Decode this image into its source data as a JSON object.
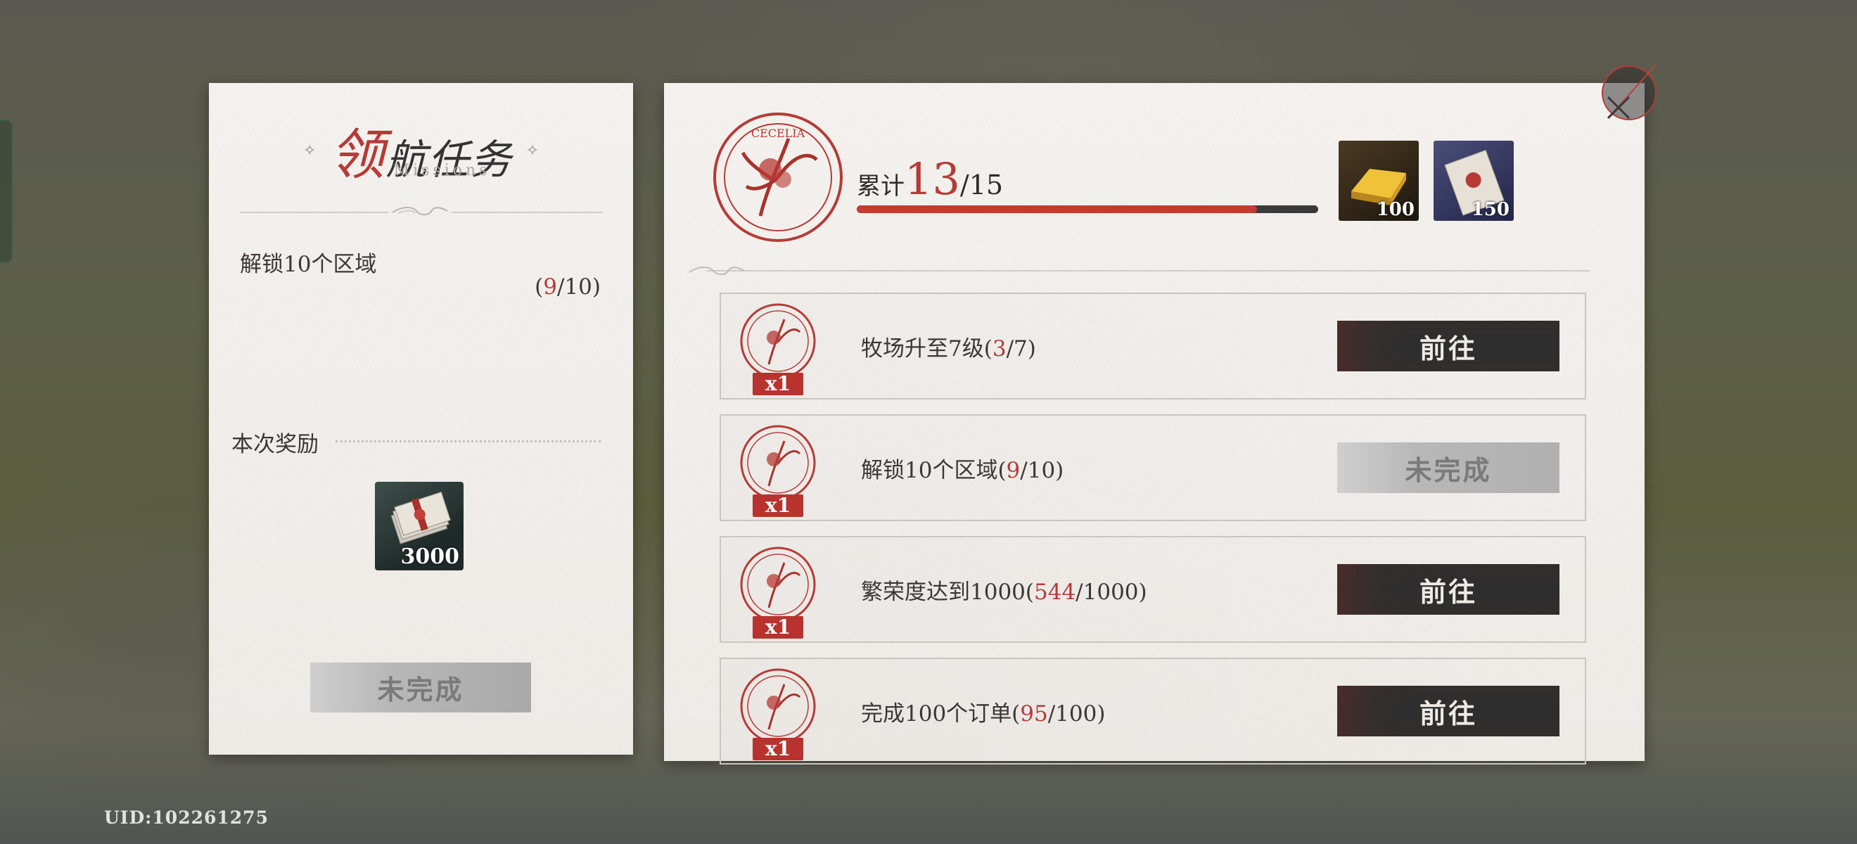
{
  "left_panel": {
    "title_first_char": "领",
    "title_rest": "航任务",
    "title_deco": "✧",
    "subtitle": "Missions",
    "mission_name": "解锁10个区域",
    "mission_progress": {
      "open": "(",
      "current": "9",
      "sep_max": "/10)"
    },
    "reward_label": "本次奖励",
    "reward": {
      "icon": "cash-bundle-icon",
      "quantity": "3000"
    },
    "status_button": "未完成"
  },
  "right_panel": {
    "seal_text": "CECELIA",
    "total": {
      "label": "累计",
      "current": "13",
      "max": "/15",
      "progress": 0.867
    },
    "milestone_rewards": [
      {
        "icon": "gold-bar-icon",
        "quantity": "100"
      },
      {
        "icon": "sealed-letter-icon",
        "quantity": "150"
      }
    ],
    "missions": [
      {
        "text_pre": "牧场升至7级(",
        "current": "3",
        "text_post": "/7)",
        "reward_badge": "x1",
        "button": "前往",
        "state": "go"
      },
      {
        "text_pre": "解锁10个区域(",
        "current": "9",
        "text_post": "/10)",
        "reward_badge": "x1",
        "button": "未完成",
        "state": "incomplete"
      },
      {
        "text_pre": "繁荣度达到1000(",
        "current": "544",
        "text_post": "/1000)",
        "reward_badge": "x1",
        "button": "前往",
        "state": "go"
      },
      {
        "text_pre": "完成100个订单(",
        "current": "95",
        "text_post": "/100)",
        "reward_badge": "x1",
        "button": "前往",
        "state": "go"
      }
    ]
  },
  "uid": "UID:102261275",
  "colors": {
    "accent_red": "#b63a36",
    "button_dark": "#2f2f2f",
    "paper": "#f2f0ec"
  }
}
